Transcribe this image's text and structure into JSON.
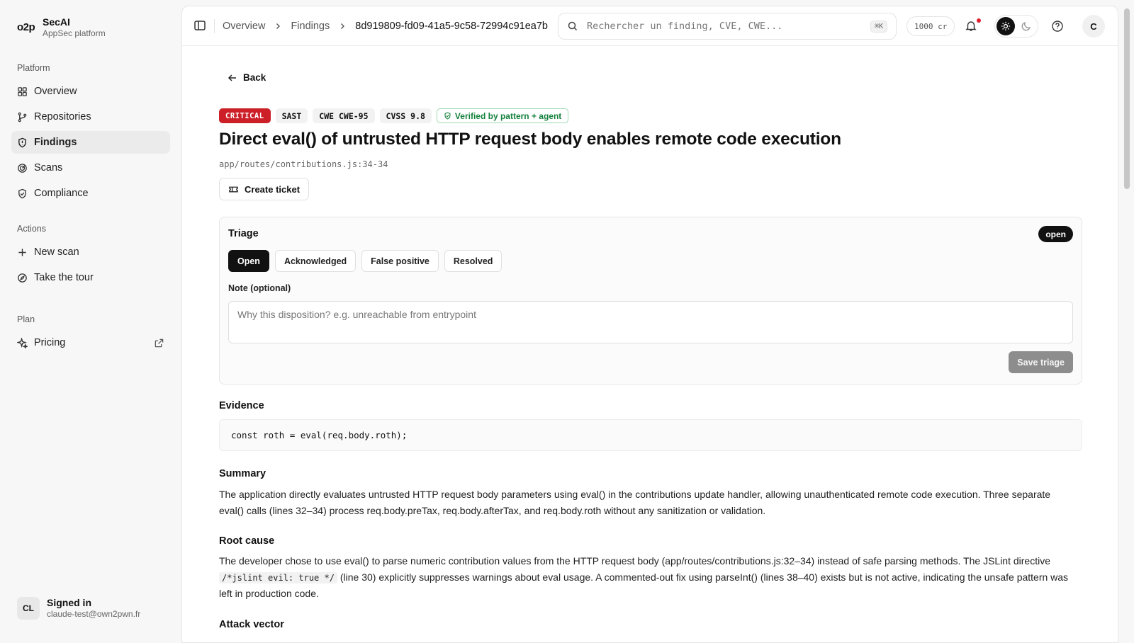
{
  "brand": {
    "logo": "o2p",
    "name": "SecAI",
    "subtitle": "AppSec platform"
  },
  "sidebar": {
    "platform_title": "Platform",
    "platform_items": [
      {
        "label": "Overview",
        "icon": "grid-icon"
      },
      {
        "label": "Repositories",
        "icon": "git-branch-icon"
      },
      {
        "label": "Findings",
        "icon": "shield-icon",
        "active": true
      },
      {
        "label": "Scans",
        "icon": "radar-icon"
      },
      {
        "label": "Compliance",
        "icon": "shield-check-icon"
      }
    ],
    "actions_title": "Actions",
    "action_items": [
      {
        "label": "New scan",
        "icon": "plus-icon"
      },
      {
        "label": "Take the tour",
        "icon": "compass-icon"
      }
    ],
    "plan_title": "Plan",
    "plan_items": [
      {
        "label": "Pricing",
        "icon": "sparkle-icon"
      }
    ],
    "user": {
      "initials": "CL",
      "status": "Signed in",
      "email": "claude-test@own2pwn.fr"
    }
  },
  "topbar": {
    "breadcrumb": [
      "Overview",
      "Findings",
      "8d919809-fd09-41a5-9c58-72994c91ea7b"
    ],
    "search_placeholder": "Rechercher un finding, CVE, CWE...",
    "search_shortcut": "⌘K",
    "credits": "1000 cr",
    "avatar": "C"
  },
  "finding": {
    "back_label": "Back",
    "badges": {
      "severity": "CRITICAL",
      "type": "SAST",
      "cwe": "CWE CWE-95",
      "cvss": "CVSS 9.8",
      "verified": "Verified by pattern + agent"
    },
    "title": "Direct eval() of untrusted HTTP request body enables remote code execution",
    "location": "app/routes/contributions.js:34-34",
    "create_ticket": "Create ticket",
    "triage": {
      "title": "Triage",
      "status": "open",
      "options": [
        "Open",
        "Acknowledged",
        "False positive",
        "Resolved"
      ],
      "selected": "Open",
      "note_label": "Note (optional)",
      "note_placeholder": "Why this disposition? e.g. unreachable from entrypoint",
      "save_label": "Save triage"
    },
    "evidence_title": "Evidence",
    "evidence_code": "const roth = eval(req.body.roth);",
    "summary_title": "Summary",
    "summary_text": "The application directly evaluates untrusted HTTP request body parameters using eval() in the contributions update handler, allowing unauthenticated remote code execution. Three separate eval() calls (lines 32–34) process req.body.preTax, req.body.afterTax, and req.body.roth without any sanitization or validation.",
    "root_cause_title": "Root cause",
    "root_cause_pre": "The developer chose to use eval() to parse numeric contribution values from the HTTP request body (app/routes/contributions.js:32–34) instead of safe parsing methods. The JSLint directive",
    "root_cause_code": "/*jslint evil: true */",
    "root_cause_post": "(line 30) explicitly suppresses warnings about eval usage. A commented-out fix using parseInt() (lines 38–40) exists but is not active, indicating the unsafe pattern was left in production code.",
    "attack_vector_title": "Attack vector"
  }
}
